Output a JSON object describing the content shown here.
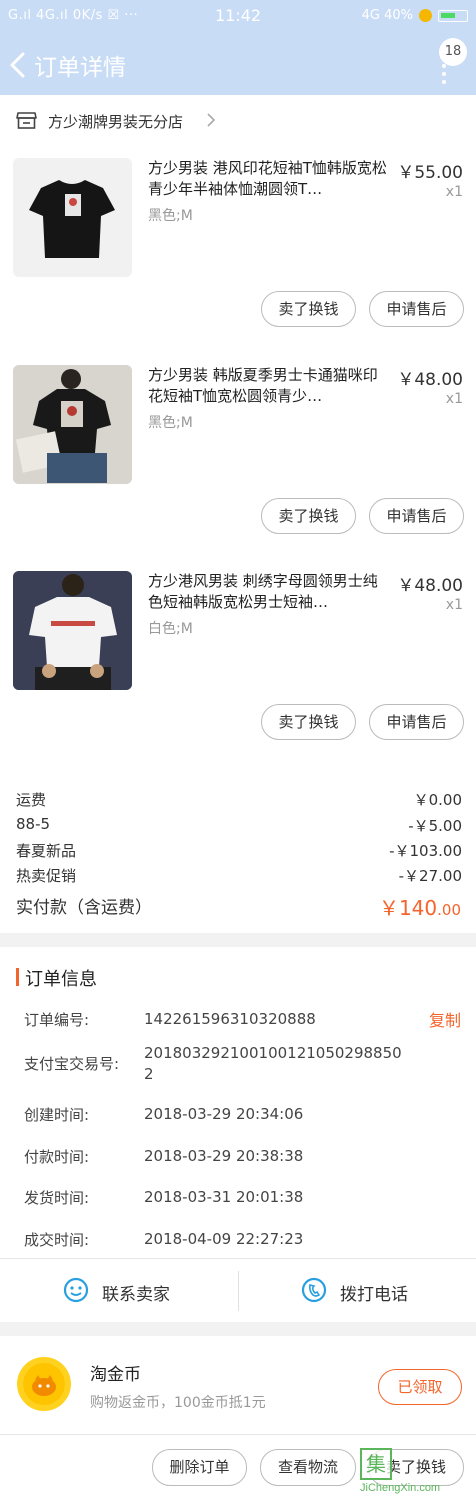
{
  "status_bar": {
    "left": "G.ıl 4G.ıl 0K/s ☒ ···",
    "time": "11:42",
    "right_text": "4G 40%"
  },
  "nav": {
    "title": "订单详情",
    "badge_count": "18",
    "back_icon": "chevron-left-icon",
    "more_icon": "vertical-dots-icon"
  },
  "shop": {
    "name": "方少潮牌男装无分店",
    "icon": "store-icon"
  },
  "items": [
    {
      "title": "方少男装 港风印花短袖T恤韩版宽松青少年半袖体恤潮圆领T…",
      "sku": "黑色;M",
      "price": "￥55.00",
      "qty": "x1",
      "sell_label": "卖了换钱",
      "after_label": "申请售后"
    },
    {
      "title": "方少男装 韩版夏季男士卡通猫咪印花短袖T恤宽松圆领青少…",
      "sku": "黑色;M",
      "price": "￥48.00",
      "qty": "x1",
      "sell_label": "卖了换钱",
      "after_label": "申请售后"
    },
    {
      "title": "方少港风男装 刺绣字母圆领男士纯色短袖韩版宽松男士短袖…",
      "sku": "白色;M",
      "price": "￥48.00",
      "qty": "x1",
      "sell_label": "卖了换钱",
      "after_label": "申请售后"
    }
  ],
  "fees": [
    {
      "label": "运费",
      "value": "￥0.00"
    },
    {
      "label": "88-5",
      "value": "-￥5.00"
    },
    {
      "label": "春夏新品",
      "value": "-￥103.00"
    },
    {
      "label": "热卖促销",
      "value": "-￥27.00"
    }
  ],
  "total": {
    "label": "实付款（含运费）",
    "currency": "￥",
    "int": "140",
    "dec": ".00"
  },
  "order_info": {
    "title": "订单信息",
    "copy_label": "复制",
    "rows": [
      {
        "label": "订单编号:",
        "value": "142261596310320888"
      },
      {
        "label": "支付宝交易号:",
        "value": "201803292100100121050298850 2"
      },
      {
        "label": "创建时间:",
        "value": "2018-03-29 20:34:06"
      },
      {
        "label": "付款时间:",
        "value": "2018-03-29 20:38:38"
      },
      {
        "label": "发货时间:",
        "value": "2018-03-31 20:01:38"
      },
      {
        "label": "成交时间:",
        "value": "2018-04-09 22:27:23"
      }
    ]
  },
  "contact": {
    "seller_label": "联系卖家",
    "phone_label": "拨打电话"
  },
  "coins": {
    "title": "淘金币",
    "desc": "购物返金币，100金币抵1元",
    "button": "已领取"
  },
  "bottom": {
    "delete_label": "删除订单",
    "logistics_label": "查看物流",
    "sell_label": "卖了换钱"
  },
  "watermark": {
    "mark": "集",
    "site": "JiChengXin.com"
  },
  "colors": {
    "header": "#c8dcf6",
    "accent": "#f5642b",
    "icon_blue": "#2a9fe0"
  }
}
